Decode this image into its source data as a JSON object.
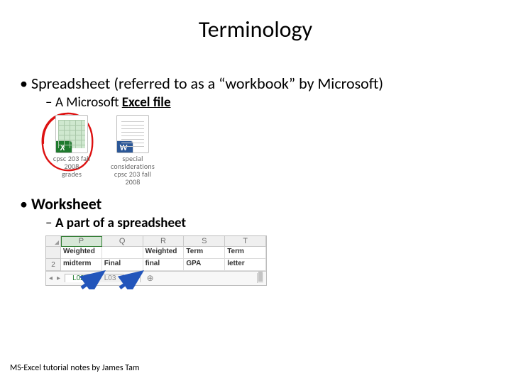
{
  "title": "Terminology",
  "spreadsheet": {
    "heading": "Spreadsheet (referred to as a “workbook” by Microsoft)",
    "sub_prefix": "A Microsoft ",
    "sub_underlined": "Excel file",
    "excel_icon_caption_l1": "cpsc 203 fall 2008",
    "excel_icon_caption_l2": "grades",
    "word_icon_caption_l1": "special",
    "word_icon_caption_l2": "considerations",
    "word_icon_caption_l3": "cpsc 203 fall 2008"
  },
  "worksheet": {
    "heading": "Worksheet",
    "sub": "A part of a spreadsheet",
    "cols": [
      "P",
      "Q",
      "R",
      "S",
      "T"
    ],
    "row1": [
      "Weighted",
      "",
      "Weighted",
      "Term",
      "Term"
    ],
    "row2": [
      "midterm",
      "Final",
      "final",
      "GPA",
      "letter"
    ],
    "row_label": "2",
    "tab_active": "L02",
    "tab_inactive": "L03",
    "tab_dots": "..."
  },
  "footer": "MS-Excel tutorial notes by James Tam"
}
